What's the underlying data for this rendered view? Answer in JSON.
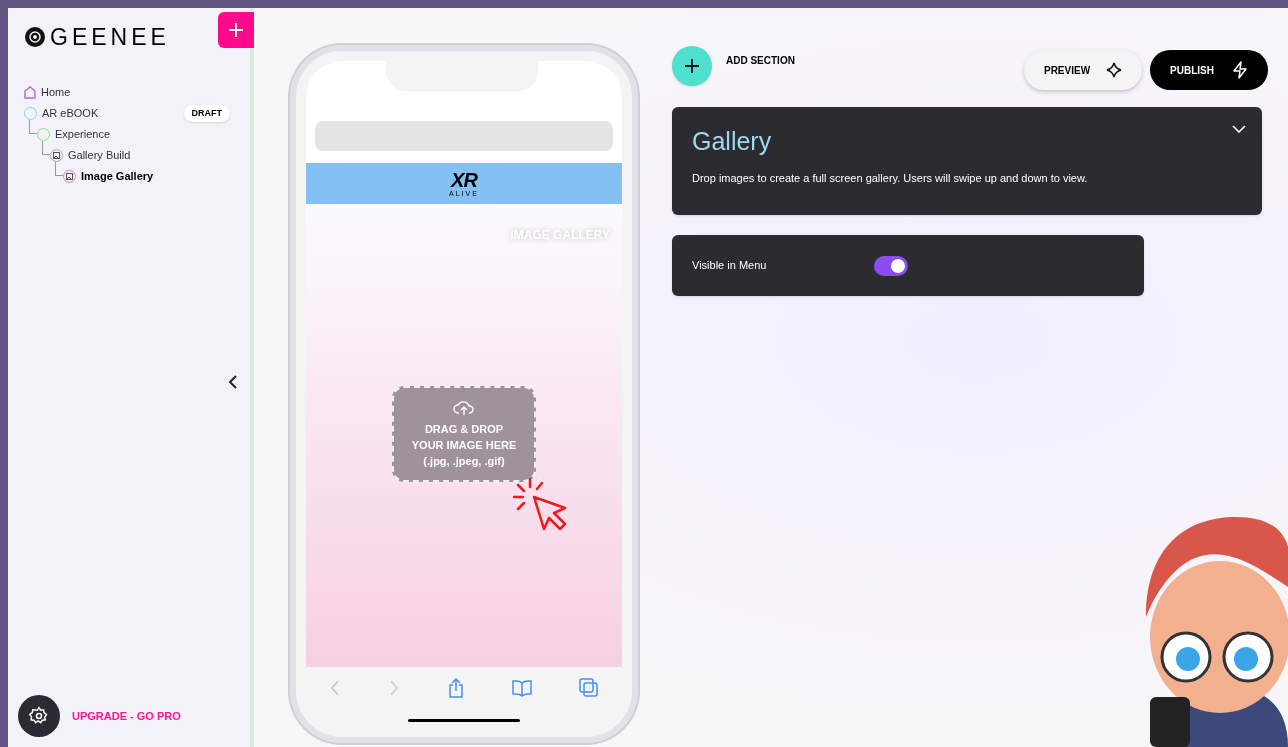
{
  "brand": {
    "name": "GEENEE"
  },
  "tree": [
    {
      "label": "Home",
      "kind": "home",
      "selected": false
    },
    {
      "label": "AR eBOOK",
      "kind": "project",
      "badge": "DRAFT",
      "selected": false,
      "children": [
        {
          "label": "Experience",
          "kind": "experience",
          "selected": false,
          "children": [
            {
              "label": "Gallery Build",
              "kind": "section",
              "selected": false,
              "children": [
                {
                  "label": "Image Gallery",
                  "kind": "section",
                  "selected": true
                }
              ]
            }
          ]
        }
      ]
    }
  ],
  "sidebar_footer": {
    "upgrade": "UPGRADE - GO PRO"
  },
  "phone": {
    "logo_top": "XR",
    "logo_bottom": "ALIVE",
    "section_label": "IMAGE GALLERY",
    "drop_lines": [
      "DRAG & DROP",
      "YOUR IMAGE HERE",
      "(.jpg, .jpeg, .gif)"
    ]
  },
  "toolbar": {
    "add_section": "ADD SECTION",
    "preview": "PREVIEW",
    "publish": "PUBLISH"
  },
  "panel": {
    "title": "Gallery",
    "description": "Drop images to create a full screen gallery. Users will swipe up and down to view.",
    "expanded": true
  },
  "settings": [
    {
      "label": "Visible in Menu",
      "on": true
    }
  ]
}
